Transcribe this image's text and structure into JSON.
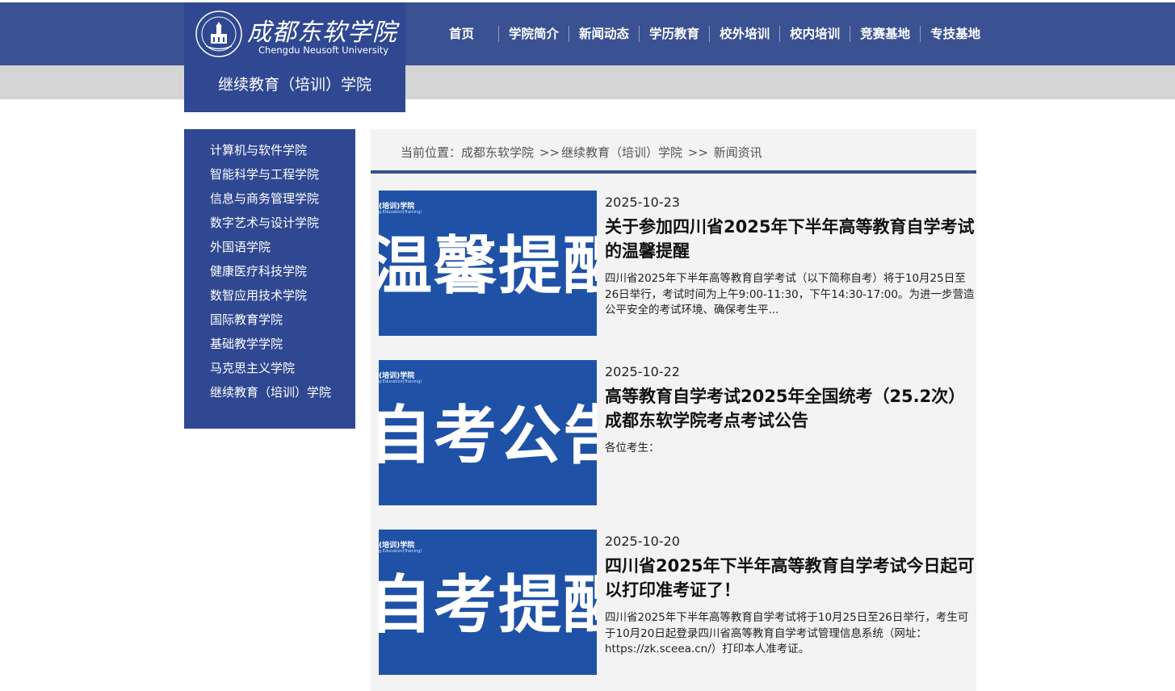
{
  "header": {
    "logo_cn": "成都东软学院",
    "logo_en": "Chengdu Neusoft University",
    "subtitle": "继续教育（培训）学院",
    "nav": [
      "首页",
      "学院简介",
      "新闻动态",
      "学历教育",
      "校外培训",
      "校内培训",
      "竞赛基地",
      "专技基地"
    ]
  },
  "sidebar": {
    "items": [
      "计算机与软件学院",
      "智能科学与工程学院",
      "信息与商务管理学院",
      "数字艺术与设计学院",
      "外国语学院",
      "健康医疗科技学院",
      "数智应用技术学院",
      "国际教育学院",
      "基础教学学院",
      "马克思主义学院",
      "继续教育（培训）学院"
    ]
  },
  "breadcrumb": {
    "prefix": "当前位置：",
    "items": [
      "成都东软学院",
      "继续教育（培训）学院",
      "新闻资讯"
    ],
    "separator": ">>"
  },
  "news": [
    {
      "date": "2025-10-23",
      "title": "关于参加四川省2025年下半年高等教育自学考试的温馨提醒",
      "summary": "四川省2025年下半年高等教育自学考试（以下简称自考）将于10月25日至26日举行，考试时间为上午9:00-11:30，下午14:30-17:00。为进一步营造公平安全的考试环境、确保考生平...",
      "thumb_tag": "(培训)学院",
      "thumb_tag_en": "g Education(Training)",
      "thumb_text": "温馨提醒"
    },
    {
      "date": "2025-10-22",
      "title": "高等教育自学考试2025年全国统考（25.2次）成都东软学院考点考试公告",
      "summary": "各位考生：",
      "thumb_tag": "(培训)学院",
      "thumb_tag_en": "g Education(Training)",
      "thumb_text": "自考公告"
    },
    {
      "date": "2025-10-20",
      "title": "四川省2025年下半年高等教育自学考试今日起可以打印准考证了！",
      "summary": "四川省2025年下半年高等教育自学考试将于10月25日至26日举行，考生可于10月20日起登录四川省高等教育自学考试管理信息系统（网址：https://zk.sceea.cn/）打印本人准考证。",
      "thumb_tag": "(培训)学院",
      "thumb_tag_en": "g Education(Training)",
      "thumb_text": "自考提醒"
    }
  ],
  "colors": {
    "nav_bg": "#3a5192",
    "logo_bg": "#2f4891",
    "sidebar_bg": "#2f4891",
    "thumb_bg": "#1f52a7",
    "content_bg": "#f3f3f3",
    "gray_band": "#d4d4d4"
  }
}
